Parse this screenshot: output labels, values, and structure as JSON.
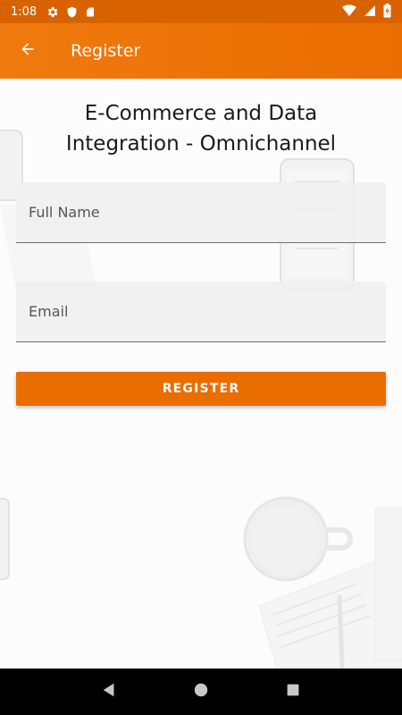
{
  "status_bar": {
    "time": "1:08",
    "icons": [
      "settings-icon",
      "shield-icon",
      "sd-card-icon"
    ],
    "right_icons": [
      "wifi-icon",
      "signal-icon",
      "battery-charging-icon"
    ]
  },
  "app_bar": {
    "back_icon": "arrow-back-icon",
    "title": "Register",
    "color": "#ea6d00"
  },
  "main": {
    "heading_line1": "E-Commerce and Data",
    "heading_line2": "Integration - Omnichannel",
    "full_name": {
      "placeholder": "Full Name",
      "value": ""
    },
    "email": {
      "placeholder": "Email",
      "value": ""
    },
    "register_label": "REGISTER"
  },
  "nav_bar": {
    "buttons": [
      "back-triangle-icon",
      "home-circle-icon",
      "recents-square-icon"
    ]
  }
}
